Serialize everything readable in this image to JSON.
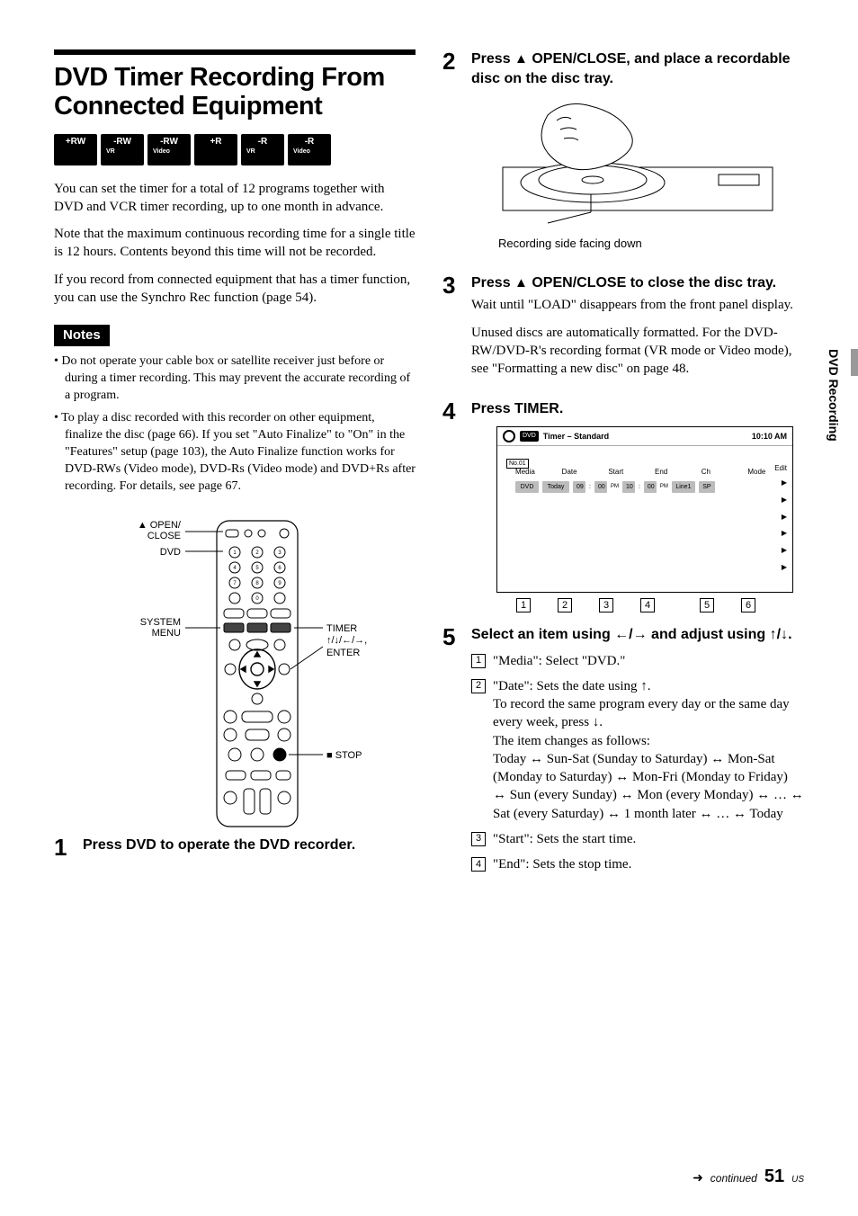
{
  "sideTab": "DVD Recording",
  "heading": "DVD Timer Recording From Connected Equipment",
  "badges": [
    "+RW",
    "-RWVR",
    "-RWVideo",
    "+R",
    "-RVR",
    "-RVideo"
  ],
  "intro1": "You can set the timer for a total of 12 programs together with DVD and VCR timer recording, up to one month in advance.",
  "intro2": "Note that the maximum continuous recording time for a single title is 12 hours. Contents beyond this time will not be recorded.",
  "intro3": "If you record from connected equipment that has a timer function, you can use the Synchro Rec function (page 54).",
  "notesHeader": "Notes",
  "note1": "Do not operate your cable box or satellite receiver just before or during a timer recording. This may prevent the accurate recording of a program.",
  "note2": "To play a disc recorded with this recorder on other equipment, finalize the disc (page 66). If you set \"Auto Finalize\" to \"On\" in the \"Features\" setup (page 103), the Auto Finalize function works for DVD-RWs (Video mode), DVD-Rs (Video mode) and DVD+Rs after recording. For details, see page 67.",
  "remoteLabels": {
    "openClose": "OPEN/\nCLOSE",
    "dvd": "DVD",
    "systemMenu": "SYSTEM\nMENU",
    "timer": "TIMER",
    "arrowsEnter": "M/m/</,,\nENTER",
    "stop": "x STOP"
  },
  "step1": {
    "num": "1",
    "head": "Press DVD to operate the DVD recorder."
  },
  "step2": {
    "num": "2",
    "head_a": "Press ",
    "head_b": " OPEN/CLOSE, and place a recordable disc on the disc tray."
  },
  "trayCaption": "Recording side facing down",
  "step3": {
    "num": "3",
    "head_a": "Press ",
    "head_b": " OPEN/CLOSE to close the disc tray.",
    "body1": "Wait until \"LOAD\" disappears from the front panel display.",
    "body2": "Unused discs are automatically formatted. For the DVD-RW/DVD-R's recording format (VR mode or Video mode), see \"Formatting a new disc\" on page 48."
  },
  "step4": {
    "num": "4",
    "head": "Press TIMER."
  },
  "timerScreen": {
    "title": "Timer – Standard",
    "clock": "10:10 AM",
    "rowLabel": "No.01",
    "edit": "Edit",
    "cols": [
      "Media",
      "Date",
      "Start",
      "End",
      "Ch",
      "Mode"
    ],
    "row": {
      "media": "DVD",
      "date": "Today",
      "startH": "09",
      "startM": "00",
      "startAP": "PM",
      "endH": "10",
      "endM": "00",
      "endAP": "PM",
      "ch": "Line1",
      "mode": "SP"
    }
  },
  "callouts": [
    "1",
    "2",
    "3",
    "4",
    "5",
    "6"
  ],
  "step5": {
    "num": "5",
    "head": "Select an item using </, and adjust using M/m.",
    "s1": {
      "num": "1",
      "text": "\"Media\": Select \"DVD.\""
    },
    "s2": {
      "num": "2",
      "lead": "\"Date\": Sets the date using M.",
      "l1": "To record the same program every day or the same day every week, press m.",
      "l2": "The item changes as follows:",
      "l3": "Today y Sun-Sat (Sunday to Saturday) y Mon-Sat (Monday to Saturday) y Mon-Fri (Monday to Friday) y Sun (every Sunday) y Mon (every Monday) y … y Sat (every Saturday) y 1 month later y … y Today"
    },
    "s3": {
      "num": "3",
      "text": "\"Start\": Sets the start time."
    },
    "s4": {
      "num": "4",
      "text": "\"End\": Sets the stop time."
    }
  },
  "footer": {
    "continued": "continued",
    "page": "51",
    "region": "US"
  }
}
